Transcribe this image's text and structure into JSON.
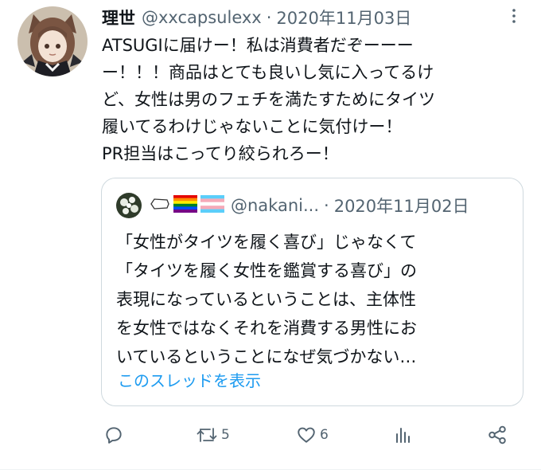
{
  "tweet": {
    "author_name": "理世",
    "handle": "@xxcapsulexx",
    "separator": "·",
    "date": "2020年11月03日",
    "text": "ATSUGIに届けー！私は消費者だぞーーーー！！！商品はとても良いし気に入ってるけど、女性は男のフェチを満たすためにタイツ履いてるわけじゃないことに気付けー！\nPR担当はこってり絞られろー！",
    "text_lines": [
      "ATSUGIに届けー！私は消費者だぞーーー",
      "ー！！！商品はとても良いし気に入ってるけ",
      "ど、女性は男のフェチを満たすためにタイツ",
      "履いてるわけじゃないことに気付けー！",
      "PR担当はこってり絞られろー！"
    ]
  },
  "quoted": {
    "handle": "@nakani...",
    "separator": "·",
    "date": "2020年11月02日",
    "flag_icons": [
      "coffin-icon",
      "rainbow-flag-icon",
      "transgender-flag-icon"
    ],
    "text_lines": [
      "「女性がタイツを履く喜び」じゃなくて",
      "「タイツを履く女性を鑑賞する喜び」の",
      "表現になっているということは、主体性",
      "を女性ではなくそれを消費する男性にお",
      "いているということになぜ気づかない…"
    ],
    "show_thread_label": "このスレッドを表示"
  },
  "actions": {
    "reply_icon": "reply-icon",
    "retweet_icon": "retweet-icon",
    "retweet_count": "5",
    "like_icon": "heart-icon",
    "like_count": "6",
    "views_icon": "analytics-icon",
    "share_icon": "share-icon"
  },
  "colors": {
    "text": "#0f1419",
    "secondary": "#536471",
    "link": "#1d9bf0",
    "border": "#cfd9de"
  }
}
